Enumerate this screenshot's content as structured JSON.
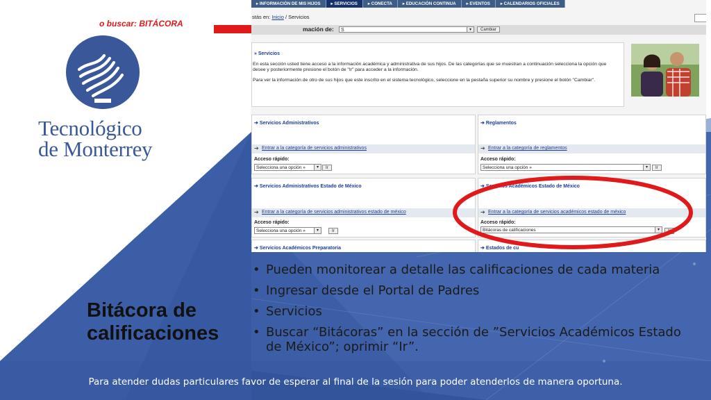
{
  "hint_text": "o buscar: BITÁCORA",
  "logo": {
    "line1": "Tecnológico",
    "line2": "de Monterrey"
  },
  "slide_title_line1": "Bitácora de",
  "slide_title_line2": "calificaciones",
  "bullets": [
    "Pueden monitorear a detalle las calificaciones de cada materia",
    "Ingresar desde el Portal de Padres",
    "Servicios",
    "Buscar “Bitácoras” en la sección de ”Servicios Académicos Estado de México”; oprimir “Ir”."
  ],
  "footer": "Para atender dudas particulares favor de esperar al final de la sesión para poder atenderlos de manera oportuna.",
  "colors": {
    "brand_blue": "#3a5799",
    "highlight_red": "#e01a1a",
    "nav_blue": "#3d5c86"
  },
  "screenshot": {
    "nav": [
      "▸ INFORMACIÓN DE MIS HIJOS",
      "▸ SERVICIOS",
      "▸ CONECTA",
      "▸ EDUCACIÓN CONTINUA",
      "▸ EVENTOS",
      "▸ CALENDARIOS OFICIALES"
    ],
    "breadcrumb_prefix": "stás en:",
    "breadcrumb_home": "Inicio",
    "breadcrumb_current": "/ Servicios",
    "selector_label": "mación de:",
    "selector_value": "S",
    "change_button": "Cambiar",
    "services_title": "» Servicios",
    "services_p1": "En esta sección usted tiene acceso a la información académica y administrativa de sus hijos. De las categorías que se muestran a continuación selecciona la opción que desee y posteriormente presione el botón de \"Ir\" para acceder a la información.",
    "services_p2": "Para ver la información de otro de sus hijos que este inscrito en el sistema tecnológico, seleccione en la pestaña superior su nombre y presione el botón \"Cambiar\".",
    "quick_label": "Acceso rápido:",
    "go_button": "Ir",
    "panels": [
      {
        "title": "Servicios Administrativos",
        "link": "Entrar a la categoría de servicios administrativos",
        "select": "Selecciona una opción »"
      },
      {
        "title": "Reglamentos",
        "link": "Entrar a la categoría de reglamentos",
        "select": "Selecciona una opción »"
      },
      {
        "title": "Servicios Administrativos Estado de México",
        "link": "Entrar a la categoría de servicios administrativos estado de méxico",
        "select": "Selecciona una opción »"
      },
      {
        "title": "Servicios Académicos Estado de México",
        "link": "Entrar a la categoría de servicios académicos estado de méxico",
        "select": "Bitácoras de calificaciones"
      }
    ],
    "bottom_left_title": "Servicios Académicos Preparatoria",
    "bottom_right_title": "Estados de cu"
  }
}
